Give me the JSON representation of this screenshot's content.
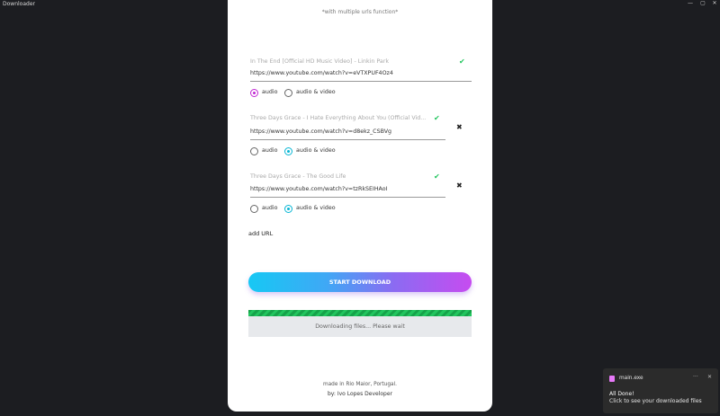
{
  "window": {
    "title": "Downloader",
    "minimize_glyph": "—",
    "maximize_glyph": "▢",
    "close_glyph": "✕"
  },
  "card": {
    "subtitle": "*with multiple urls function*",
    "entries": [
      {
        "title": "In The End [Official HD Music Video] - Linkin Park",
        "url": "https://www.youtube.com/watch?v=eVTXPUF4Oz4",
        "selected": "audio",
        "removable": false
      },
      {
        "title": "Three Days Grace - I Hate Everything About You (Official Vid...",
        "url": "https://www.youtube.com/watch?v=d8ekz_CSBVg",
        "selected": "audio & video",
        "removable": true
      },
      {
        "title": "Three Days Grace - The Good Life",
        "url": "https://www.youtube.com/watch?v=tzRkSEIHAoI",
        "selected": "audio & video",
        "removable": true
      }
    ],
    "option_audio": "audio",
    "option_audio_video": "audio & video",
    "check_glyph": "✔",
    "remove_glyph": "✖",
    "add_url_label": "add URL",
    "start_button_label": "START DOWNLOAD",
    "progress_fraction": 1.0,
    "progress_text": "Downloading files... Please wait",
    "footer_line1": "made in Rio Maior, Portugal.",
    "footer_line2": "by: Ivo Lopes Developer"
  },
  "toast": {
    "app_name": "main.exe",
    "more_glyph": "···",
    "close_glyph": "✕",
    "heading": "All Done!",
    "message": "Click to see your downloaded files"
  },
  "colors": {
    "accent_purple": "#c026d3",
    "accent_cyan": "#06b6d4",
    "success_green": "#22c55e"
  }
}
